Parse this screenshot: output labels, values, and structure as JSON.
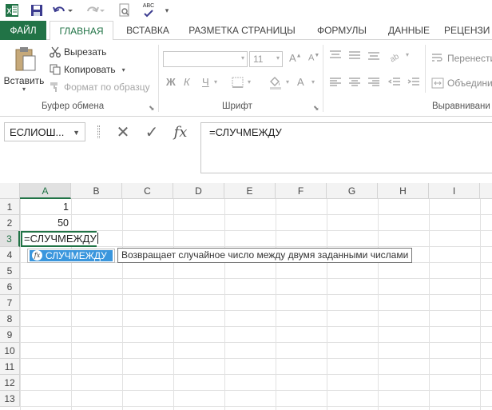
{
  "qat": {
    "app_icon": "excel-logo-icon",
    "save": "save-icon",
    "undo": "undo-icon",
    "redo": "redo-icon",
    "preview": "print-preview-icon",
    "spell": "spelling-icon",
    "spell_text": "ABC",
    "customize": "customize-qat-icon"
  },
  "tabs": [
    {
      "label": "ФАЙЛ"
    },
    {
      "label": "ГЛАВНАЯ"
    },
    {
      "label": "ВСТАВКА"
    },
    {
      "label": "РАЗМЕТКА СТРАНИЦЫ"
    },
    {
      "label": "ФОРМУЛЫ"
    },
    {
      "label": "ДАННЫЕ"
    },
    {
      "label": "РЕЦЕНЗИ"
    }
  ],
  "ribbon": {
    "clipboard": {
      "label": "Буфер обмена",
      "paste": "Вставить",
      "cut": "Вырезать",
      "copy": "Копировать",
      "format_painter": "Формат по образцу"
    },
    "font": {
      "label": "Шрифт",
      "font_name": "",
      "font_size": "11",
      "bold": "Ж",
      "italic": "К",
      "underline": "Ч"
    },
    "alignment": {
      "label": "Выравнивани",
      "wrap": "Перенести",
      "merge": "Объедини"
    }
  },
  "formula_bar": {
    "name_box": "ЕСЛИОШ...",
    "cancel": "✕",
    "enter": "✓",
    "fx": "fx",
    "content": "=СЛУЧМЕЖДУ"
  },
  "grid": {
    "columns": [
      "A",
      "B",
      "C",
      "D",
      "E",
      "F",
      "G",
      "H",
      "I"
    ],
    "rows": [
      "1",
      "2",
      "3",
      "4",
      "5",
      "6",
      "7",
      "8",
      "9",
      "10",
      "11",
      "12",
      "13"
    ],
    "cells": {
      "A1": "1",
      "A2": "50",
      "A3": "=СЛУЧМЕЖДУ"
    }
  },
  "autocomplete": {
    "item": "СЛУЧМЕЖДУ",
    "icon": "fx",
    "tooltip": "Возвращает случайное число между двумя заданными числами"
  },
  "colors": {
    "accent": "#217346",
    "selection": "#3a96dd"
  }
}
